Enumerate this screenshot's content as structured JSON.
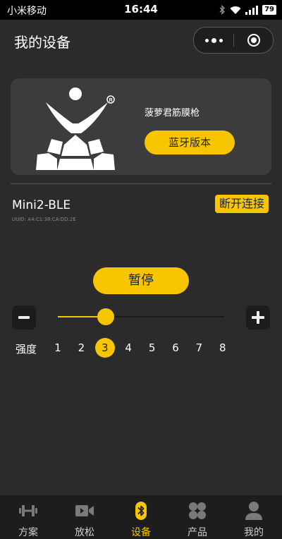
{
  "status_bar": {
    "carrier": "小米移动",
    "time": "16:44",
    "battery": "79"
  },
  "header": {
    "title": "我的设备"
  },
  "card": {
    "product_name": "菠萝君筋膜枪",
    "bt_button": "蓝牙版本"
  },
  "device": {
    "name": "Mini2-BLE",
    "uuid": "UUID: A4:C1:38:CA:DD:2E",
    "disconnect": "断开连接"
  },
  "controls": {
    "pause": "暂停",
    "strength_label": "强度",
    "levels": [
      "1",
      "2",
      "3",
      "4",
      "5",
      "6",
      "7",
      "8"
    ],
    "selected_level": 3,
    "slider_fraction": 0.29
  },
  "tabs": [
    {
      "label": "方案",
      "icon": "dumbbell-icon"
    },
    {
      "label": "放松",
      "icon": "video-icon"
    },
    {
      "label": "设备",
      "icon": "bluetooth-icon",
      "active": true
    },
    {
      "label": "产品",
      "icon": "grid-icon"
    },
    {
      "label": "我的",
      "icon": "user-icon"
    }
  ],
  "colors": {
    "accent": "#f7c600",
    "background": "#2b2b2b",
    "card": "#3c3c3c",
    "tabbar": "#1d1d1d"
  }
}
